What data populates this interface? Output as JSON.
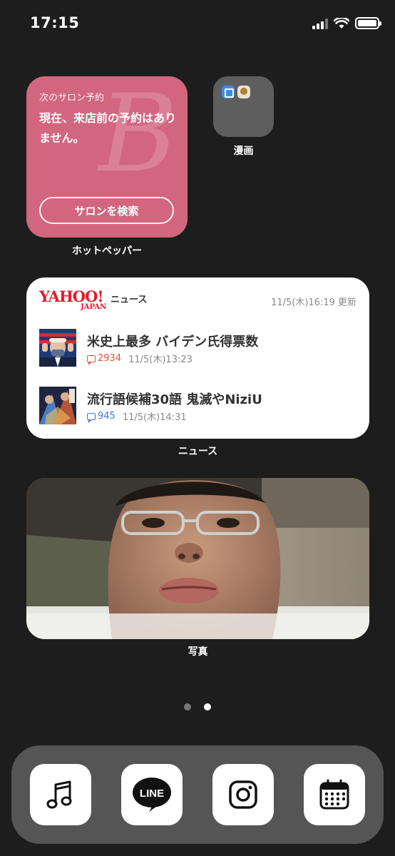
{
  "status_bar": {
    "time": "17:15",
    "signal_bars_active": 3,
    "signal_bars_total": 4,
    "battery_level": 1.0
  },
  "hotpepper_widget": {
    "subtitle": "次のサロン予約",
    "message": "現在、来店前の予約はありません。",
    "logo_letter": "B",
    "button_label": "サロンを検索",
    "app_label": "ホットペッパー",
    "background_color": "#d3667f"
  },
  "manga_folder": {
    "label": "漫画",
    "apps": [
      "blue-app-icon",
      "manga-app-icon"
    ]
  },
  "news_widget": {
    "logo_text": "YAHOO!",
    "logo_sub": "JAPAN",
    "tag": "ニュース",
    "updated": "11/5(木)16:19 更新",
    "articles": [
      {
        "title": "米史上最多 バイデン氏得票数",
        "comments": "2934",
        "comment_color": "#e0533b",
        "time": "11/5(木)13:23",
        "thumb": "biden-photo"
      },
      {
        "title": "流行語候補30語 鬼滅やNiziU",
        "comments": "945",
        "comment_color": "#3f78c9",
        "time": "11/5(木)14:31",
        "thumb": "anime-poster"
      }
    ],
    "app_label": "ニュース"
  },
  "photos_widget": {
    "app_label": "写真",
    "image": "selfie-photo"
  },
  "page_indicator": {
    "pages": 2,
    "current": 2
  },
  "dock": {
    "apps": [
      "music-app",
      "line-app",
      "instagram-app",
      "calendar-app"
    ],
    "line_text": "LINE"
  }
}
